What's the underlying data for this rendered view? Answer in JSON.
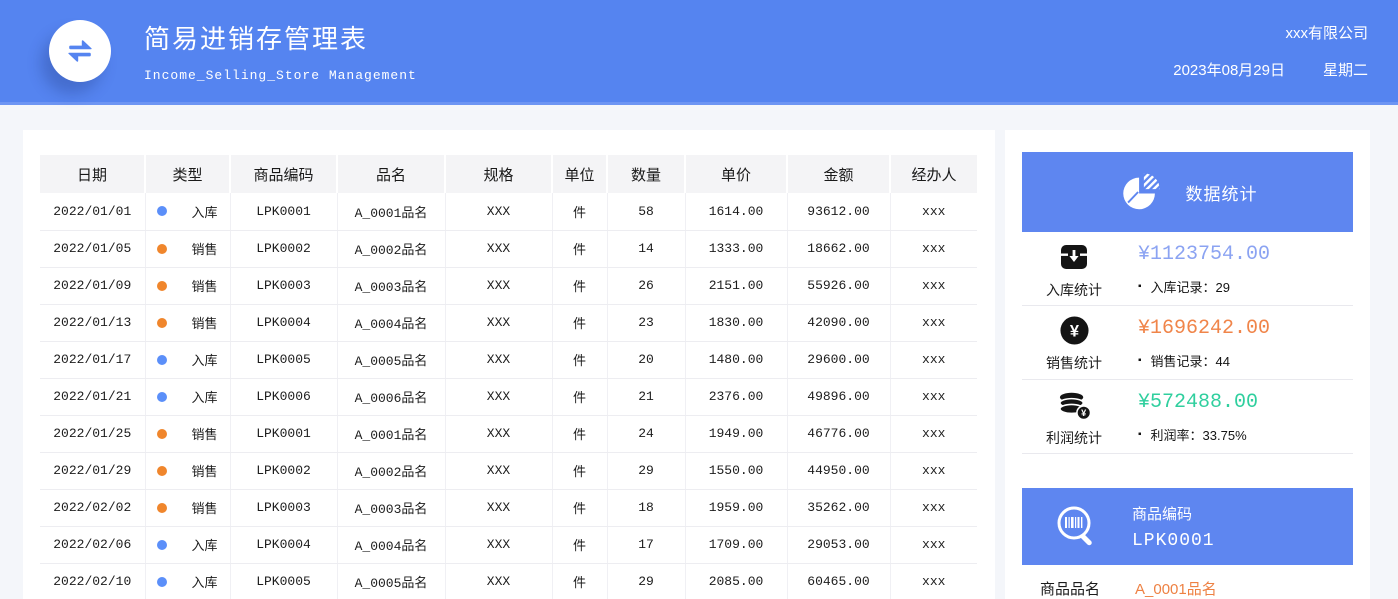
{
  "header": {
    "title": "简易进销存管理表",
    "subtitle": "Income_Selling_Store Management",
    "company": "xxx有限公司",
    "date": "2023年08月29日",
    "weekday": "星期二"
  },
  "table": {
    "columns": [
      "日期",
      "类型",
      "商品编码",
      "品名",
      "规格",
      "单位",
      "数量",
      "单价",
      "金额",
      "经办人"
    ],
    "rows": [
      {
        "date": "2022/01/01",
        "type": "入库",
        "dot": "#5b8ff9",
        "code": "LPK0001",
        "name": "A_0001品名",
        "spec": "XXX",
        "unit": "件",
        "qty": "58",
        "price": "1614.00",
        "amount": "93612.00",
        "handler": "xxx"
      },
      {
        "date": "2022/01/05",
        "type": "销售",
        "dot": "#f0862c",
        "code": "LPK0002",
        "name": "A_0002品名",
        "spec": "XXX",
        "unit": "件",
        "qty": "14",
        "price": "1333.00",
        "amount": "18662.00",
        "handler": "xxx"
      },
      {
        "date": "2022/01/09",
        "type": "销售",
        "dot": "#f0862c",
        "code": "LPK0003",
        "name": "A_0003品名",
        "spec": "XXX",
        "unit": "件",
        "qty": "26",
        "price": "2151.00",
        "amount": "55926.00",
        "handler": "xxx"
      },
      {
        "date": "2022/01/13",
        "type": "销售",
        "dot": "#f0862c",
        "code": "LPK0004",
        "name": "A_0004品名",
        "spec": "XXX",
        "unit": "件",
        "qty": "23",
        "price": "1830.00",
        "amount": "42090.00",
        "handler": "xxx"
      },
      {
        "date": "2022/01/17",
        "type": "入库",
        "dot": "#5b8ff9",
        "code": "LPK0005",
        "name": "A_0005品名",
        "spec": "XXX",
        "unit": "件",
        "qty": "20",
        "price": "1480.00",
        "amount": "29600.00",
        "handler": "xxx"
      },
      {
        "date": "2022/01/21",
        "type": "入库",
        "dot": "#5b8ff9",
        "code": "LPK0006",
        "name": "A_0006品名",
        "spec": "XXX",
        "unit": "件",
        "qty": "21",
        "price": "2376.00",
        "amount": "49896.00",
        "handler": "xxx"
      },
      {
        "date": "2022/01/25",
        "type": "销售",
        "dot": "#f0862c",
        "code": "LPK0001",
        "name": "A_0001品名",
        "spec": "XXX",
        "unit": "件",
        "qty": "24",
        "price": "1949.00",
        "amount": "46776.00",
        "handler": "xxx"
      },
      {
        "date": "2022/01/29",
        "type": "销售",
        "dot": "#f0862c",
        "code": "LPK0002",
        "name": "A_0002品名",
        "spec": "XXX",
        "unit": "件",
        "qty": "29",
        "price": "1550.00",
        "amount": "44950.00",
        "handler": "xxx"
      },
      {
        "date": "2022/02/02",
        "type": "销售",
        "dot": "#f0862c",
        "code": "LPK0003",
        "name": "A_0003品名",
        "spec": "XXX",
        "unit": "件",
        "qty": "18",
        "price": "1959.00",
        "amount": "35262.00",
        "handler": "xxx"
      },
      {
        "date": "2022/02/06",
        "type": "入库",
        "dot": "#5b8ff9",
        "code": "LPK0004",
        "name": "A_0004品名",
        "spec": "XXX",
        "unit": "件",
        "qty": "17",
        "price": "1709.00",
        "amount": "29053.00",
        "handler": "xxx"
      },
      {
        "date": "2022/02/10",
        "type": "入库",
        "dot": "#5b8ff9",
        "code": "LPK0005",
        "name": "A_0005品名",
        "spec": "XXX",
        "unit": "件",
        "qty": "29",
        "price": "2085.00",
        "amount": "60465.00",
        "handler": "xxx"
      }
    ]
  },
  "stats": {
    "title": "数据统计",
    "items": [
      {
        "label": "入库统计",
        "value": "¥1123754.00",
        "detail": "入库记录：29",
        "icon": "inbound-box-icon",
        "value_color": "#8ba3f2"
      },
      {
        "label": "销售统计",
        "value": "¥1696242.00",
        "detail": "销售记录：44",
        "icon": "yen-coin-icon",
        "value_color": "#f0854a"
      },
      {
        "label": "利润统计",
        "value": "¥572488.00",
        "detail": "利润率：33.75%",
        "icon": "coins-stack-icon",
        "value_color": "#2fcf9e"
      }
    ]
  },
  "product": {
    "code_label": "商品编码",
    "code": "LPK0001",
    "name_label": "商品品名",
    "name": "A_0001品名"
  },
  "colors": {
    "header_blue": "#5584f0",
    "panel_blue": "#5e86f0",
    "inbound_dot": "#5b8ff9",
    "sale_dot": "#f0862c",
    "value_blue": "#8ba3f2",
    "value_orange": "#f0854a",
    "value_green": "#2fcf9e",
    "product_name_orange": "#ee8143"
  }
}
